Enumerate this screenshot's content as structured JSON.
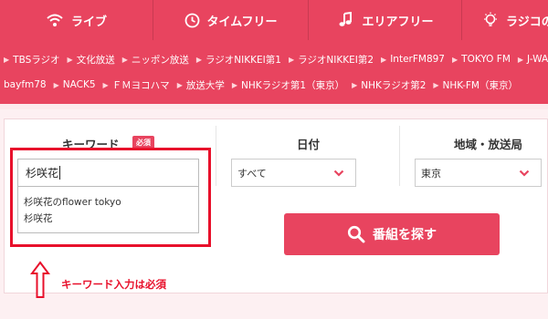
{
  "colors": {
    "brand": "#e8445f",
    "annotation": "#e8102b"
  },
  "nav": {
    "tabs": [
      {
        "label": "ライブ",
        "icon": "wifi-icon"
      },
      {
        "label": "タイムフリー",
        "icon": "clock-icon"
      },
      {
        "label": "エリアフリー",
        "icon": "music-note-icon"
      },
      {
        "label": "ラジコの",
        "icon": "lightbulb-icon"
      }
    ]
  },
  "stations": {
    "row1": [
      "TBSラジオ",
      "文化放送",
      "ニッポン放送",
      "ラジオNIKKEI第1",
      "ラジオNIKKEI第2",
      "InterFM897",
      "TOKYO FM",
      "J-WA"
    ],
    "row2": [
      "bayfm78",
      "NACK5",
      "ＦＭヨコハマ",
      "放送大学",
      "NHKラジオ第1（東京）",
      "NHKラジオ第2",
      "NHK-FM（東京）"
    ]
  },
  "search": {
    "keyword_label": "キーワード",
    "required_badge": "必須",
    "keyword_value": "杉咲花",
    "suggestions": [
      "杉咲花のflower tokyo",
      "杉咲花"
    ],
    "date_label": "日付",
    "date_value": "すべて",
    "area_label": "地域・放送局",
    "area_value": "東京",
    "button_label": "番組を探す"
  },
  "annotation": {
    "note": "キーワード入力は必須"
  }
}
